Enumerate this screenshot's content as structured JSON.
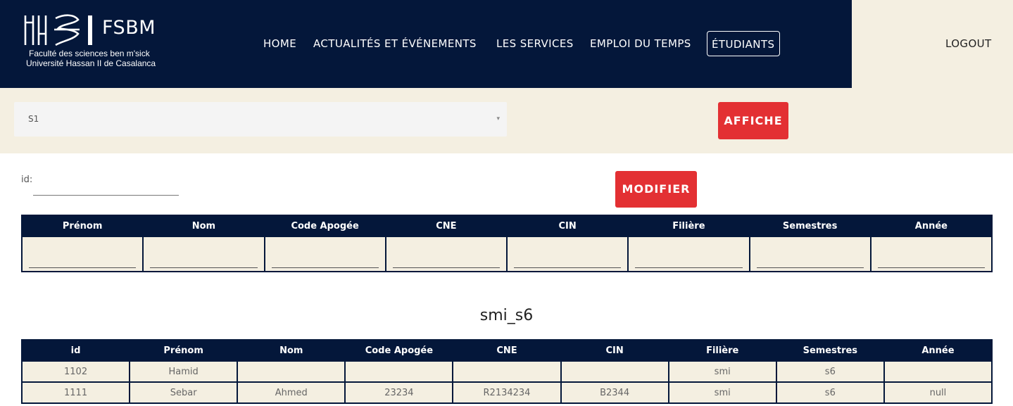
{
  "brand": {
    "abbr": "FSBM",
    "line1": "Faculté des sciences ben m'sick",
    "line2": "Université Hassan II de Casalanca"
  },
  "nav": {
    "items": [
      {
        "label": "HOME"
      },
      {
        "label": "ACTUALITÉS ET ÉVÉNEMENTS"
      },
      {
        "label": "LES SERVICES"
      },
      {
        "label": "EMPLOI DU TEMPS"
      },
      {
        "label": "ÉTUDIANTS"
      }
    ],
    "active": "ÉTUDIANTS",
    "logout": "LOGOUT"
  },
  "filter": {
    "selected": "S1",
    "button": "AFFICHE"
  },
  "edit": {
    "id_label": "id:",
    "button": "MODIFIER",
    "columns": [
      "Prénom",
      "Nom",
      "Code Apogée",
      "CNE",
      "CIN",
      "Filière",
      "Semestres",
      "Année"
    ]
  },
  "list": {
    "title": "smi_s6",
    "columns": [
      "id",
      "Prénom",
      "Nom",
      "Code Apogée",
      "CNE",
      "CIN",
      "Filière",
      "Semestres",
      "Année"
    ],
    "rows": [
      [
        "1102",
        "Hamid",
        "",
        "",
        "",
        "",
        "smi",
        "s6",
        ""
      ],
      [
        "1111",
        "Sebar",
        "Ahmed",
        "23234",
        "R2134234",
        "B2344",
        "smi",
        "s6",
        "null"
      ]
    ]
  },
  "colors": {
    "navy": "#04173a",
    "cream": "#f4efe1",
    "red": "#e33033"
  }
}
